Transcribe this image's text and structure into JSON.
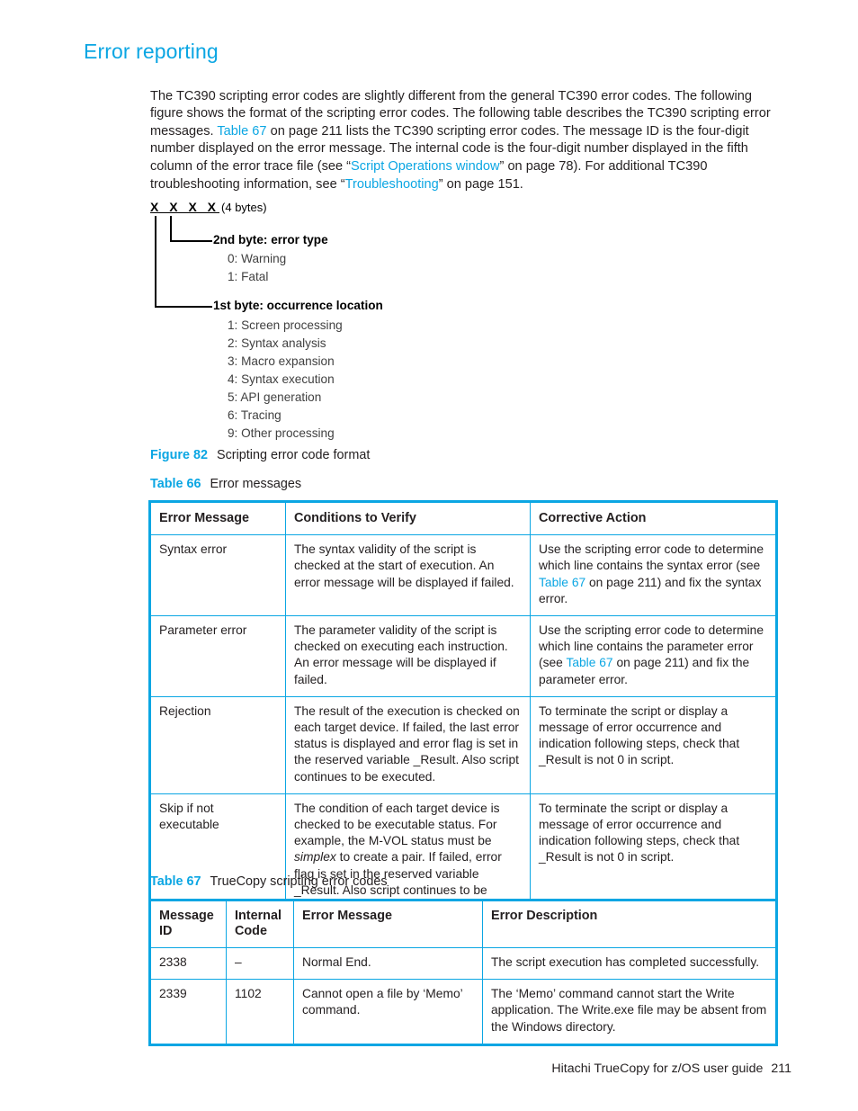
{
  "colors": {
    "accent": "#0BA6E3",
    "text": "#231f20",
    "table_border": "#0BA6E3"
  },
  "heading": {
    "title": "Error reporting"
  },
  "intro": {
    "part1": "The TC390 scripting error codes are slightly different from the general TC390 error codes. The following figure shows the format of the scripting error codes. The following table describes the TC390 scripting error messages. ",
    "link1": "Table 67",
    "part2": " on page 211 lists the TC390 scripting error codes. The message ID is the four-digit number displayed on the error message. The internal code is the four-digit number displayed in the fifth column of the error trace file (see “",
    "link2": "Script Operations window",
    "part3": "” on page 78). For additional TC390 troubleshooting information, see “",
    "link3": "Troubleshooting",
    "part4": "” on page 151."
  },
  "figure": {
    "bits": "X X X X",
    "bytes_note": "(4 bytes)",
    "byte2": {
      "label": "2nd byte: error type",
      "items": [
        "0: Warning",
        "1: Fatal"
      ]
    },
    "byte1": {
      "label": "1st byte: occurrence location",
      "items": [
        "1: Screen processing",
        "2: Syntax analysis",
        "3: Macro expansion",
        "4: Syntax execution",
        "5: API generation",
        "6: Tracing",
        "9: Other processing"
      ]
    },
    "caption_number": "Figure 82",
    "caption_text": "Scripting error code format"
  },
  "table66": {
    "caption_number": "Table 66",
    "caption_text": "Error messages",
    "headers": [
      "Error Message",
      "Conditions to Verify",
      "Corrective Action"
    ],
    "rows": [
      {
        "error_message": "Syntax error",
        "conditions": "The syntax validity of the script is checked at the start of execution. An error message will be displayed if failed.",
        "action_part1": "Use the scripting error code to determine which line contains the syntax error (see ",
        "action_link": "Table 67",
        "action_part2": " on page 211) and fix the syntax error."
      },
      {
        "error_message": "Parameter error",
        "conditions": "The parameter validity of the script is checked on executing each instruction. An error message will be displayed if failed.",
        "action_part1": "Use the scripting error code to determine which line contains the parameter error (see ",
        "action_link": "Table 67",
        "action_part2": " on page 211) and fix the parameter error."
      },
      {
        "error_message": "Rejection",
        "conditions": "The result of the execution is checked on each target device. If failed, the last error status is displayed and error flag is set in the reserved variable _Result. Also script continues to be executed.",
        "action_part1": "To terminate the script or display a message of error occurrence and indication following steps, check that _Result is not 0 in script.",
        "action_link": "",
        "action_part2": ""
      },
      {
        "error_message": "Skip if not executable",
        "conditions_part1": "The condition of each target device is checked to be executable status. For example, the M-VOL status must be ",
        "conditions_italic": "simplex",
        "conditions_part2": " to create a pair. If failed, error flag is set in the reserved variable _Result. Also script continues to be executed.",
        "action_part1": "To terminate the script or display a message of error occurrence and indication following steps, check that _Result is not 0 in script.",
        "action_link": "",
        "action_part2": ""
      }
    ]
  },
  "table67": {
    "caption_number": "Table 67",
    "caption_text": "TrueCopy scripting error codes",
    "headers": [
      "Message ID",
      "Internal Code",
      "Error Message",
      "Error Description"
    ],
    "rows": [
      {
        "message_id": "2338",
        "internal_code": "–",
        "error_message": "Normal End.",
        "error_description": "The script execution has completed successfully."
      },
      {
        "message_id": "2339",
        "internal_code": "1102",
        "error_message": "Cannot open a file by ‘Memo’ command.",
        "error_description": "The ‘Memo’ command cannot start the Write application. The Write.exe file may be absent from the Windows directory."
      }
    ]
  },
  "footer": {
    "guide_title": "Hitachi TrueCopy for z/OS user guide",
    "page_number": "211"
  }
}
